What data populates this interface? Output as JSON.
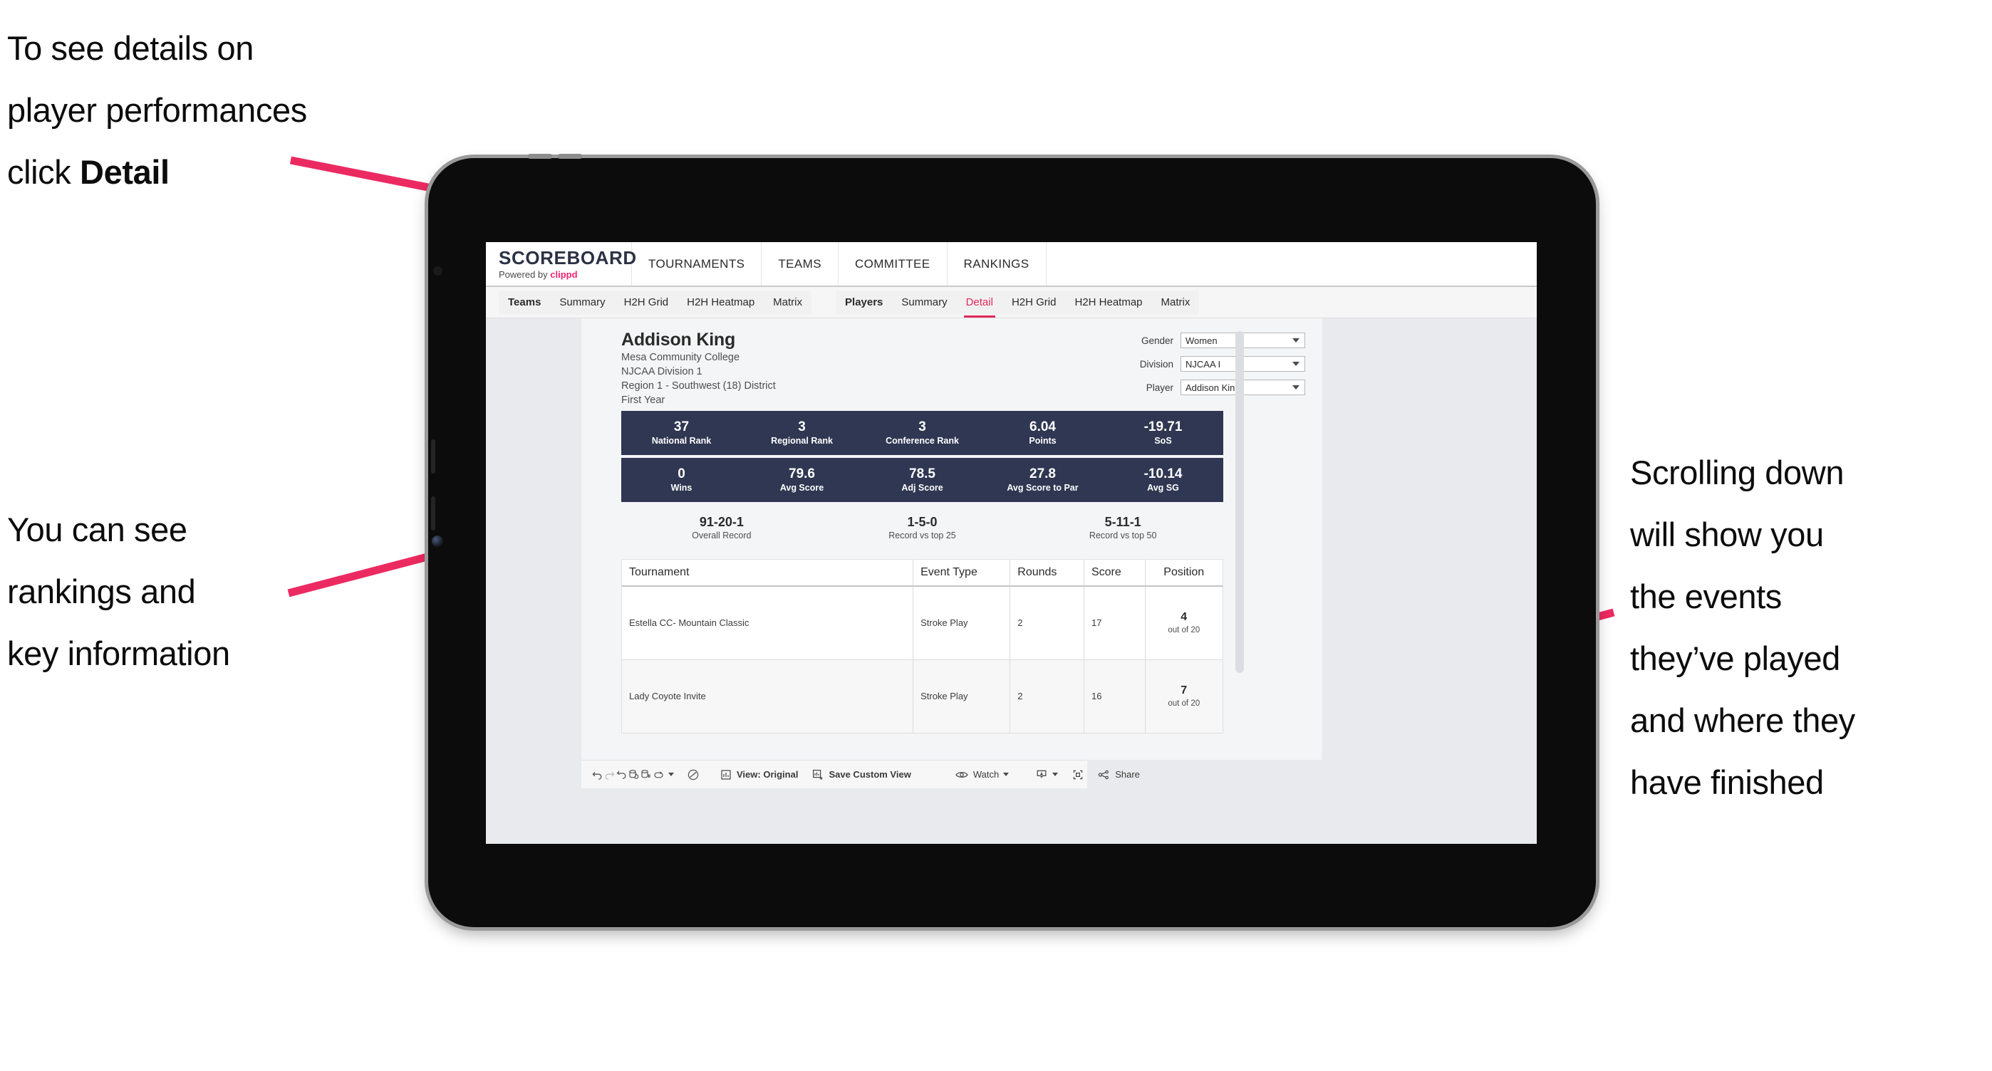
{
  "annotations": {
    "detail": "To see details on\nplayer performances\nclick ",
    "detail_bold": "Detail",
    "rankings": "You can see\nrankings and\nkey information",
    "scrolling": "Scrolling down\nwill show you\nthe events\nthey’ve played\nand where they\nhave finished"
  },
  "brand": {
    "title": "SCOREBOARD",
    "powered_prefix": "Powered by ",
    "powered_name": "clippd"
  },
  "topnav": [
    {
      "label": "TOURNAMENTS"
    },
    {
      "label": "TEAMS"
    },
    {
      "label": "COMMITTEE"
    },
    {
      "label": "RANKINGS"
    }
  ],
  "subnav": {
    "group_teams": [
      {
        "label": "Teams",
        "active": false,
        "lead": true
      },
      {
        "label": "Summary",
        "active": false
      },
      {
        "label": "H2H Grid",
        "active": false
      },
      {
        "label": "H2H Heatmap",
        "active": false
      },
      {
        "label": "Matrix",
        "active": false
      }
    ],
    "group_players": [
      {
        "label": "Players",
        "active": false,
        "lead": true
      },
      {
        "label": "Summary",
        "active": false
      },
      {
        "label": "Detail",
        "active": true
      },
      {
        "label": "H2H Grid",
        "active": false
      },
      {
        "label": "H2H Heatmap",
        "active": false
      },
      {
        "label": "Matrix",
        "active": false
      }
    ]
  },
  "player": {
    "name": "Addison King",
    "college": "Mesa Community College",
    "division": "NJCAA Division 1",
    "region": "Region 1 - Southwest (18) District",
    "year": "First Year"
  },
  "filters": [
    {
      "label": "Gender",
      "value": "Women"
    },
    {
      "label": "Division",
      "value": "NJCAA I"
    },
    {
      "label": "Player",
      "value": "Addison King"
    }
  ],
  "stats_row1": [
    {
      "value": "37",
      "label": "National Rank"
    },
    {
      "value": "3",
      "label": "Regional Rank"
    },
    {
      "value": "3",
      "label": "Conference Rank"
    },
    {
      "value": "6.04",
      "label": "Points"
    },
    {
      "value": "-19.71",
      "label": "SoS"
    }
  ],
  "stats_row2": [
    {
      "value": "0",
      "label": "Wins"
    },
    {
      "value": "79.6",
      "label": "Avg Score"
    },
    {
      "value": "78.5",
      "label": "Adj Score"
    },
    {
      "value": "27.8",
      "label": "Avg Score to Par"
    },
    {
      "value": "-10.14",
      "label": "Avg SG"
    }
  ],
  "records": [
    {
      "value": "91-20-1",
      "label": "Overall Record"
    },
    {
      "value": "1-5-0",
      "label": "Record vs top 25"
    },
    {
      "value": "5-11-1",
      "label": "Record vs top 50"
    }
  ],
  "table": {
    "headers": [
      "Tournament",
      "Event Type",
      "Rounds",
      "Score",
      "Position"
    ],
    "rows": [
      {
        "tournament": "Estella CC- Mountain Classic",
        "event_type": "Stroke Play",
        "rounds": "2",
        "score": "17",
        "position": "4",
        "position_sub": "out of 20"
      },
      {
        "tournament": "Lady Coyote Invite",
        "event_type": "Stroke Play",
        "rounds": "2",
        "score": "16",
        "position": "7",
        "position_sub": "out of 20"
      }
    ]
  },
  "toolbar": {
    "view_label": "View: Original",
    "save_label": "Save Custom View",
    "watch_label": "Watch",
    "share_label": "Share"
  },
  "colors": {
    "accent_pink": "#ec2a62",
    "tab_active": "#e12a5c",
    "stat_bar": "#2f3752",
    "brand_pink": "#f0256e"
  }
}
